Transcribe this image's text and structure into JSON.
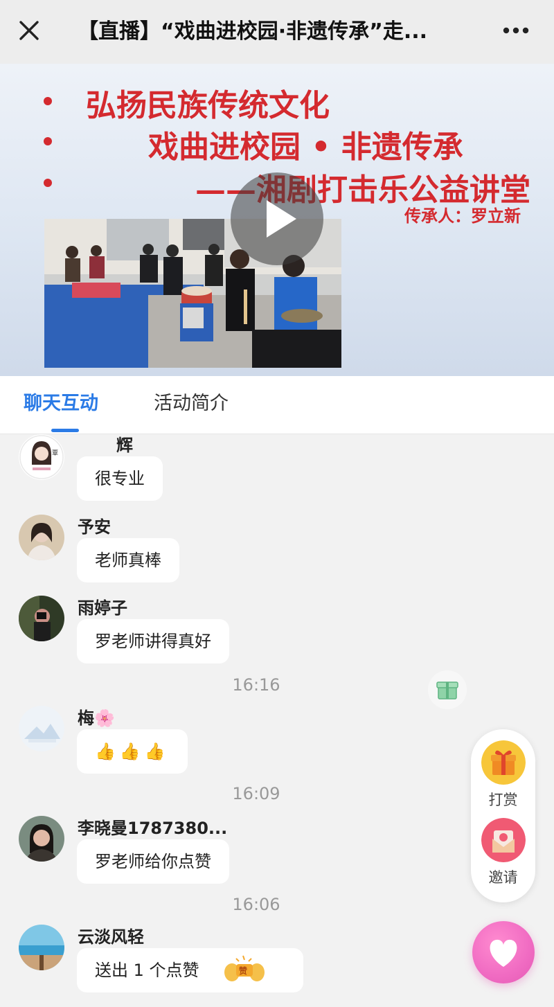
{
  "header": {
    "title": "【直播】“戏曲进校园·非遗传承”走...",
    "close_icon": "close-icon",
    "more_icon": "more-icon"
  },
  "video": {
    "lines": [
      "弘扬民族传统文化",
      "戏曲进校园 • 非遗传承",
      "——湘剧打击乐公益讲堂"
    ],
    "inheritor": "传承人：罗立新",
    "play_icon": "play-icon"
  },
  "tabs": [
    {
      "label": "聊天互动",
      "active": true
    },
    {
      "label": "活动简介",
      "active": false
    }
  ],
  "messages": [
    {
      "user": "辉",
      "text": "很专业"
    },
    {
      "user": "予安",
      "text": "老师真棒"
    },
    {
      "user": "雨婷子",
      "text": "罗老师讲得真好"
    },
    {
      "time": "16:16"
    },
    {
      "user": "梅🌸",
      "text": "👍👍👍"
    },
    {
      "time": "16:09"
    },
    {
      "user": "李晓曼1787380...",
      "text": "罗老师给你点赞"
    },
    {
      "time": "16:06"
    },
    {
      "user": "云淡风轻",
      "text": "送出 1 个点赞"
    }
  ],
  "side": {
    "reward_label": "打赏",
    "invite_label": "邀请"
  },
  "colors": {
    "accent": "#2b7be6",
    "title_red": "#d42a2f",
    "like": "#f06bc2"
  }
}
